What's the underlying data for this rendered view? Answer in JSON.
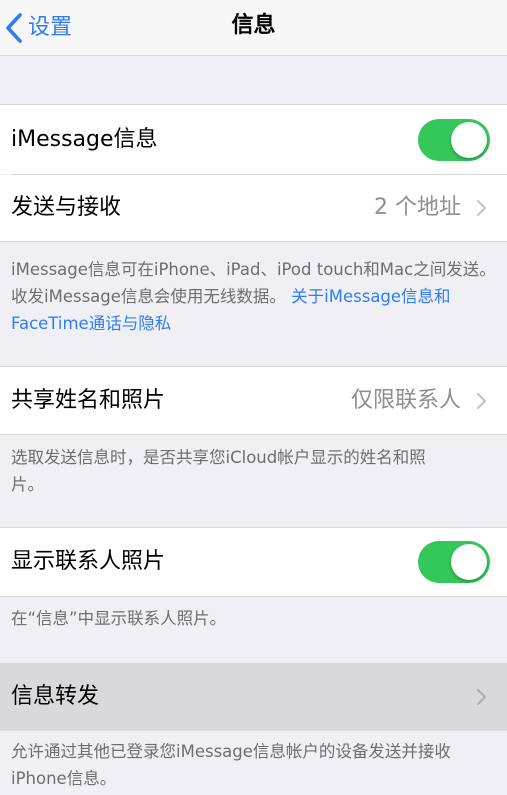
{
  "navbar": {
    "back_label": "设置",
    "title": "信息"
  },
  "imessage": {
    "label": "iMessage信息",
    "toggle_on": true
  },
  "send_receive": {
    "label": "发送与接收",
    "value": "2 个地址"
  },
  "imessage_footer": {
    "text": "iMessage信息可在iPhone、iPad、iPod touch和Mac之间发送。收发iMessage信息会使用无线数据。",
    "link": "关于iMessage信息和FaceTime通话与隐私"
  },
  "share_name_photo": {
    "label": "共享姓名和照片",
    "value": "仅限联系人"
  },
  "share_footer": {
    "text": "选取发送信息时，是否共享您iCloud帐户显示的姓名和照片。"
  },
  "show_contact_photos": {
    "label": "显示联系人照片",
    "toggle_on": true
  },
  "contact_photos_footer": {
    "text": "在“信息”中显示联系人照片。"
  },
  "forwarding": {
    "label": "信息转发"
  },
  "forwarding_footer": {
    "text": "允许通过其他已登录您iMessage信息帐户的设备发送并接收iPhone信息。"
  },
  "colors": {
    "accent": "#2f7cf6",
    "toggle_on": "#34c759",
    "group_background": "#efeff4",
    "highlight_row": "#d9d9dc"
  },
  "icons": [
    "chevron-left-icon",
    "chevron-right-icon"
  ]
}
